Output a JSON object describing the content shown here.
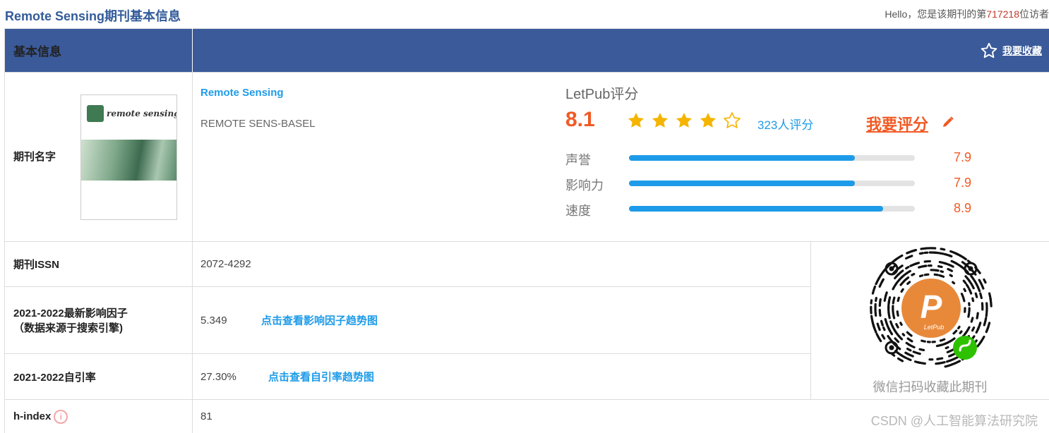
{
  "header": {
    "page_title": "Remote Sensing期刊基本信息",
    "greeting_prefix": "Hello，您是该期刊的第",
    "visitor_count": "717218",
    "greeting_suffix": "位访者"
  },
  "section": {
    "title": "基本信息",
    "favorite_label": "我要收藏",
    "favorite_icon": "star-outline-icon"
  },
  "journal": {
    "name_label": "期刊名字",
    "full_name": "Remote Sensing",
    "abbreviation": "REMOTE SENS-BASEL",
    "cover_title": "remote sensing"
  },
  "rating": {
    "title": "LetPub评分",
    "score": "8.1",
    "stars_filled": 4,
    "stars_total": 5,
    "raters": "323人评分",
    "rate_me": "我要评分",
    "colors": {
      "accent": "#f15a24",
      "bar": "#1e9be8",
      "star": "#f5b400"
    },
    "bars": [
      {
        "label": "声誉",
        "value": "7.9",
        "fraction": 0.79
      },
      {
        "label": "影响力",
        "value": "7.9",
        "fraction": 0.79
      },
      {
        "label": "速度",
        "value": "8.9",
        "fraction": 0.89
      }
    ]
  },
  "rows": {
    "issn_label": "期刊ISSN",
    "issn_value": "2072-4292",
    "if_label_line1": "2021-2022最新影响因子",
    "if_label_line2": "（数据来源于搜索引擎)",
    "if_value": "5.349",
    "if_link": "点击查看影响因子趋势图",
    "self_cite_label": "2021-2022自引率",
    "self_cite_value": "27.30%",
    "self_cite_link": "点击查看自引率趋势图",
    "hindex_label": "h-index",
    "hindex_value": "81"
  },
  "qr": {
    "caption": "微信扫码收藏此期刊",
    "center_letter": "P",
    "center_text": "LetPub"
  },
  "watermark": "CSDN @人工智能算法研究院"
}
